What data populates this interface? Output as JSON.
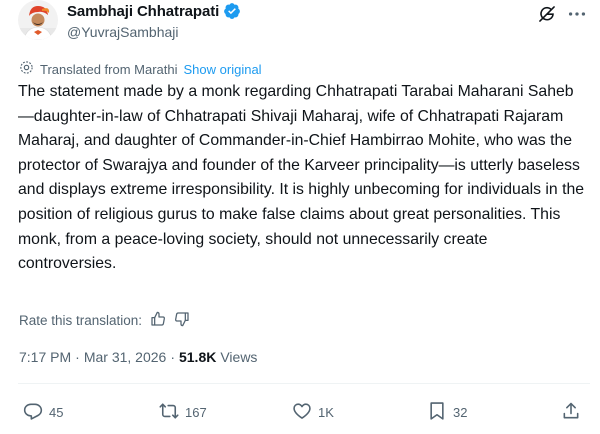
{
  "author": {
    "name": "Sambhaji Chhatrapati",
    "handle": "@YuvrajSambhaji",
    "verified_color": "#1d9bf0"
  },
  "header_icons": [
    "grok-icon",
    "more-icon"
  ],
  "translation": {
    "label": "Translated from Marathi",
    "show_original": "Show original"
  },
  "tweet": {
    "text": "The statement made by a monk regarding Chhatrapati Tarabai Maharani Saheb—daughter-in-law of Chhatrapati Shivaji Maharaj, wife of Chhatrapati Rajaram Maharaj, and daughter of Commander-in-Chief Hambirrao Mohite, who was the protector of Swarajya and founder of the Karveer principality—is utterly baseless and displays extreme irresponsibility. It is highly unbecoming for individuals in the position of religious gurus to make false claims about great personalities. This monk, from a peace-loving society, should not unnecessarily create controversies."
  },
  "rate": {
    "label": "Rate this translation:"
  },
  "meta": {
    "time": "7:17 PM",
    "sep1": "·",
    "date": "Mar 31, 2026",
    "sep2": "·",
    "views_count": "51.8K",
    "views_label": "Views"
  },
  "actions": {
    "replies": "45",
    "reposts": "167",
    "likes": "1K",
    "bookmarks": "32"
  },
  "colors": {
    "text": "#0f1419",
    "secondary": "#536471",
    "link": "#1d9bf0",
    "divider": "#eff3f4"
  }
}
